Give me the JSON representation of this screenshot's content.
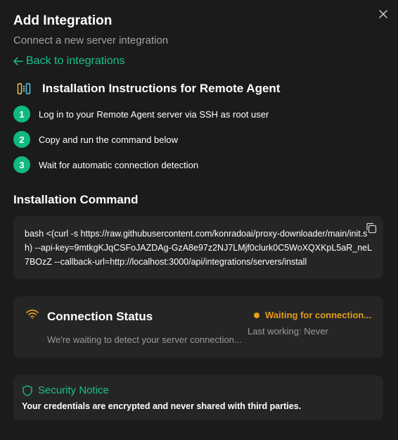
{
  "dialog": {
    "title": "Add Integration",
    "subtitle": "Connect a new server integration",
    "close_icon": "close-icon"
  },
  "back_link": {
    "label": "Back to integrations",
    "icon": "arrow-left-icon"
  },
  "instructions": {
    "title": "Installation Instructions for Remote Agent",
    "icon": "columns-icon",
    "steps": [
      {
        "number": "1",
        "text": "Log in to your Remote Agent server via SSH as root user"
      },
      {
        "number": "2",
        "text": "Copy and run the command below"
      },
      {
        "number": "3",
        "text": "Wait for automatic connection detection"
      }
    ]
  },
  "command": {
    "title": "Installation Command",
    "text": "bash <(curl -s https://raw.githubusercontent.com/konradoai/proxy-downloader/main/init.sh) --api-key=9mtkgKJqCSFoJAZDAg-GzA8e97z2NJ7LMjf0clurk0C5WoXQXKpL5aR_neL7BOzZ --callback-url=http://localhost:3000/api/integrations/servers/install",
    "copy_icon": "copy-icon"
  },
  "connection": {
    "title": "Connection Status",
    "description": "We're waiting to detect your server connection...",
    "status": "Waiting for connection...",
    "last_working": "Last working: Never",
    "icon": "wifi-icon"
  },
  "security": {
    "title": "Security Notice",
    "text": "Your credentials are encrypted and never shared with third parties.",
    "icon": "shield-icon"
  },
  "colors": {
    "background": "#1b1b1b",
    "card": "#252525",
    "accent": "#10b981",
    "warning": "#e39b1a"
  }
}
